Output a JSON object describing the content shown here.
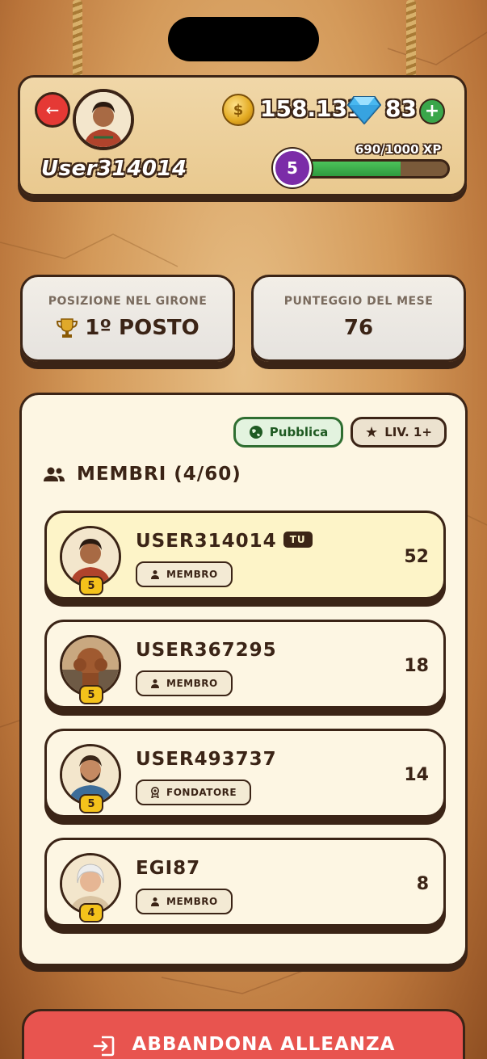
{
  "header": {
    "username": "User314014",
    "coins": "158.131",
    "gems": "83",
    "xp_text": "690/1000 XP",
    "xp_progress": 0.69,
    "level": "5"
  },
  "stats": {
    "position_label": "POSIZIONE NEL GIRONE",
    "position_value": "1º POSTO",
    "score_label": "PUNTEGGIO DEL MESE",
    "score_value": "76"
  },
  "panel": {
    "visibility_label": "Pubblica",
    "level_req_label": "LIV. 1+",
    "members_title": "MEMBRI (4/60)",
    "members": [
      {
        "name": "USER314014",
        "badge": "TU",
        "role": "MEMBRO",
        "role_icon": "person-icon",
        "level": "5",
        "score": "52"
      },
      {
        "name": "USER367295",
        "badge": "",
        "role": "MEMBRO",
        "role_icon": "person-icon",
        "level": "5",
        "score": "18"
      },
      {
        "name": "USER493737",
        "badge": "",
        "role": "FONDATORE",
        "role_icon": "medal-icon",
        "level": "5",
        "score": "14"
      },
      {
        "name": "EGI87",
        "badge": "",
        "role": "MEMBRO",
        "role_icon": "person-icon",
        "level": "4",
        "score": "8"
      }
    ]
  },
  "leave_button": "ABBANDONA ALLEANZA",
  "colors": {
    "primary_dark": "#3b2416",
    "danger": "#e8544f",
    "highlight_row": "#fdf4c8",
    "xp_green": "#3aa64a",
    "level_purple": "#7b2ca8"
  }
}
